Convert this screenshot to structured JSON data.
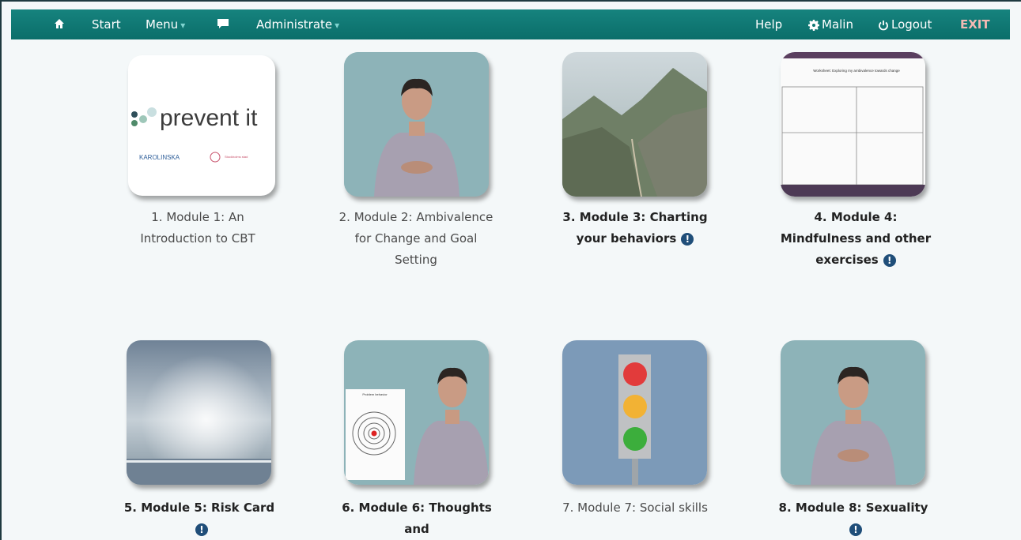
{
  "nav": {
    "start": "Start",
    "menu": "Menu",
    "administrate": "Administrate",
    "help": "Help",
    "user": "Malin",
    "logout": "Logout",
    "exit": "EXIT"
  },
  "logo": {
    "brand": "prevent it",
    "partner1": "KAROLINSKA",
    "partner2": "Stockholms stad"
  },
  "modules": [
    {
      "label": "1. Module 1: An Introduction to CBT",
      "bold": false,
      "info": false
    },
    {
      "label": "2. Module 2: Ambivalence for Change and Goal Setting",
      "bold": false,
      "info": false
    },
    {
      "label": "3. Module 3: Charting your behaviors",
      "bold": true,
      "info": true
    },
    {
      "label": "4. Module 4: Mindfulness and other exercises",
      "bold": true,
      "info": true
    },
    {
      "label": "5. Module 5: Risk Card",
      "bold": true,
      "info": true
    },
    {
      "label": "6. Module 6: Thoughts and",
      "bold": true,
      "info": false
    },
    {
      "label": "7. Module 7: Social skills",
      "bold": false,
      "info": false
    },
    {
      "label": "8. Module 8: Sexuality",
      "bold": true,
      "info": true
    }
  ],
  "worksheet_title": "Worksheet: Exploring my ambivalence towards change",
  "target_title": "Problem behavior",
  "colors": {
    "navbar": "#0b6e6a",
    "info_icon": "#1f4e79",
    "light_red": "#e23b3b",
    "light_yellow": "#f2b234",
    "light_green": "#3cae3c"
  }
}
